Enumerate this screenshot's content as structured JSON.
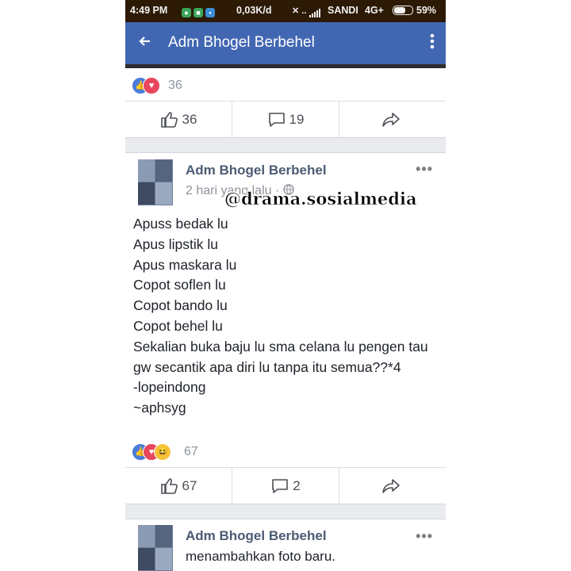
{
  "status_bar": {
    "time": "4:49 PM",
    "speed": "0,03K/d",
    "carrier": "SANDI",
    "network": "4G+",
    "battery": "59%"
  },
  "app_bar": {
    "title": "Adm Bhogel Berbehel",
    "back_icon": "arrow-left-icon",
    "menu_icon": "vertical-dots-icon"
  },
  "prev_post": {
    "reaction_count": "36",
    "like_count": "36",
    "comment_count": "19"
  },
  "post": {
    "author": "Adm Bhogel Berbehel",
    "time": "2 hari yang lalu",
    "more_icon": "horizontal-dots-icon",
    "lines": [
      "Apuss bedak lu",
      "Apus lipstik lu",
      "Apus maskara lu",
      "Copot soflen lu",
      "Copot bando lu",
      "Copot behel lu",
      "Sekalian buka baju lu sma celana lu pengen tau gw secantik apa diri lu tanpa itu semua??*4",
      "-lopeindong",
      "~aphsyg"
    ],
    "reaction_count": "67",
    "like_count": "67",
    "comment_count": "2"
  },
  "next_post": {
    "author": "Adm Bhogel Berbehel",
    "action": "menambahkan foto baru."
  },
  "watermark": "@drama.sosialmedia",
  "colors": {
    "fb_blue": "#4267b2",
    "status_bar": "#2c1a05",
    "like_blue": "#4a7ddb",
    "love_red": "#e8465d",
    "haha_yellow": "#f5c33b"
  }
}
